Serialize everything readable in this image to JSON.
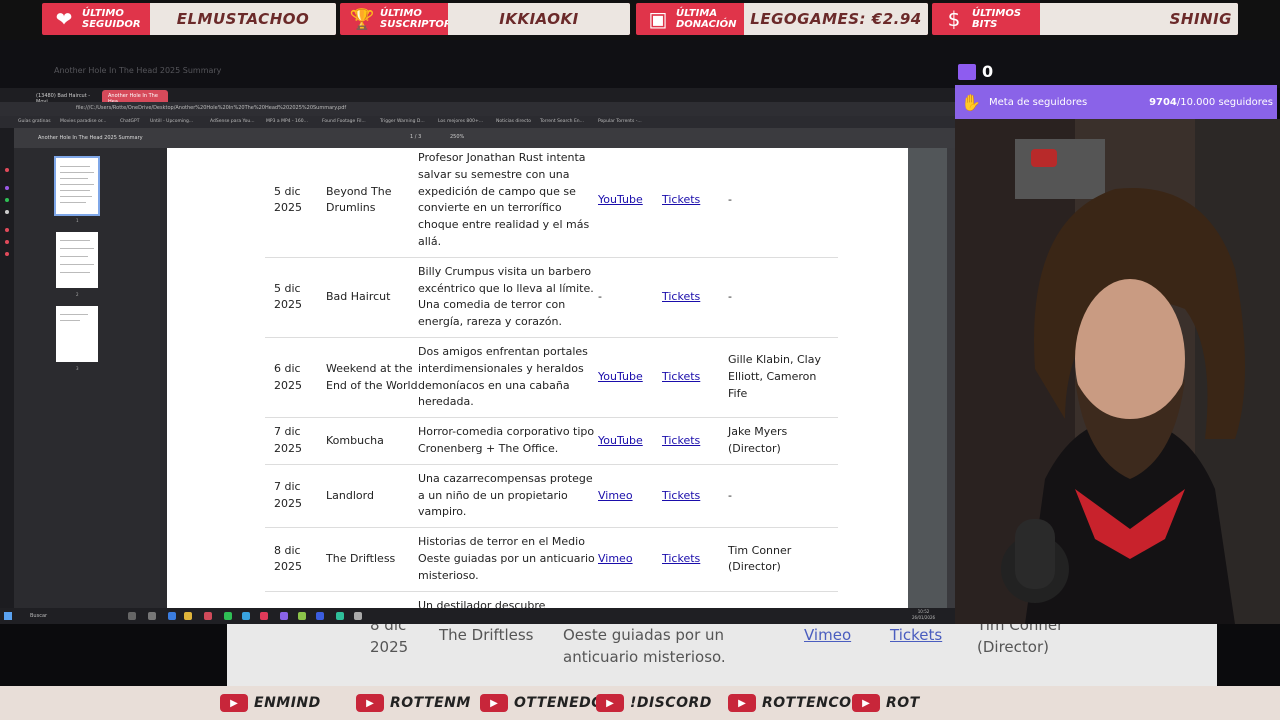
{
  "alerts": [
    {
      "label": "Último seguidor",
      "value": "ELMUSTACHOO",
      "icon": "heart-icon"
    },
    {
      "label": "Último suscriptor",
      "value": "IKKIAOKI",
      "icon": "trophy-icon"
    },
    {
      "label": "Última donación",
      "value": "LEGOGAMES: €2.94",
      "icon": "cash-register-icon"
    },
    {
      "label": "Últimos bits",
      "value": "SHINIG",
      "icon": "money-bag-icon"
    }
  ],
  "background_window": {
    "title": "Another Hole In The Head 2025 Summary"
  },
  "browser": {
    "tabs": [
      {
        "label": "(13480) Bad Haircut - Movi"
      },
      {
        "label": "Another Hole In The Hea"
      }
    ],
    "url": "file:///C:/Users/Rotte/OneDrive/Desktop/Another%20Hole%20In%20The%20Head%202025%20Summary.pdf",
    "bookmarks": [
      "Guías gratinas",
      "Movies paradise or...",
      "ChatGPT",
      "Untill - Upcoming...",
      "AdSense para You...",
      "MP3 a MP4 - 160...",
      "Found Footage Fil...",
      "Trigger Warning D...",
      "Los mejores 800+...",
      "Noticias directo",
      "Torrent Search En...",
      "Popular Torrents -..."
    ]
  },
  "pdf_viewer": {
    "title": "Another Hole In The Head 2025 Summary",
    "page_current": "1",
    "page_total": "3",
    "zoom": "250%",
    "thumbnails": [
      "1",
      "2",
      "3"
    ]
  },
  "films": [
    {
      "date": "5 dic 2025",
      "title": "Beyond The Drumlins",
      "description": "Profesor Jonathan Rust intenta salvar su semestre con una expedición de campo que se convierte en un terrorífico choque entre realidad y el más allá.",
      "trailer": "YouTube",
      "tickets": "Tickets",
      "director": "-"
    },
    {
      "date": "5 dic 2025",
      "title": "Bad Haircut",
      "description": "Billy Crumpus visita un barbero excéntrico que lo lleva al límite. Una comedia de terror con energía, rareza y corazón.",
      "trailer": "-",
      "tickets": "Tickets",
      "director": "-"
    },
    {
      "date": "6 dic 2025",
      "title": "Weekend at the End of the World",
      "description": "Dos amigos enfrentan portales interdimensionales y heraldos demoníacos en una cabaña heredada.",
      "trailer": "YouTube",
      "tickets": "Tickets",
      "director": "Gille Klabin, Clay Elliott, Cameron Fife"
    },
    {
      "date": "7 dic 2025",
      "title": "Kombucha",
      "description": "Horror-comedia corporativo tipo Cronenberg + The Office.",
      "trailer": "YouTube",
      "tickets": "Tickets",
      "director": "Jake Myers (Director)"
    },
    {
      "date": "7 dic 2025",
      "title": "Landlord",
      "description": "Una cazarrecompensas protege a un niño de un propietario vampiro.",
      "trailer": "Vimeo",
      "tickets": "Tickets",
      "director": "-"
    },
    {
      "date": "8 dic 2025",
      "title": "The Driftless",
      "description": "Historias de terror en el Medio Oeste guiadas por un anticuario misterioso.",
      "trailer": "Vimeo",
      "tickets": "Tickets",
      "director": "Tim Conner (Director)"
    },
    {
      "date": "",
      "title": "",
      "description": "Un destilador descubre",
      "trailer": "",
      "tickets": "",
      "director": ""
    }
  ],
  "taskbar": {
    "search_placeholder": "Buscar",
    "time": "10:52",
    "date": "26/01/2026"
  },
  "bg_pdf_zoom": {
    "date": "8 dic 2025",
    "title": "The Driftless",
    "description": "Oeste guiadas por un anticuario misterioso.",
    "trailer": "Vimeo",
    "tickets": "Tickets",
    "director_line1": "Tim Conner",
    "director_line2": "(Director)"
  },
  "twitch": {
    "viewer_count": "0"
  },
  "follower_goal": {
    "title": "Meta de seguidores",
    "current": "9704",
    "target": "/10.000 seguidores"
  },
  "ticker": [
    {
      "icon": "youtube-icon",
      "text": "ENMIND"
    },
    {
      "icon": "steam-icon",
      "text": "ROTTENM"
    },
    {
      "icon": "twitter-icon",
      "text": "OTTENEDGA"
    },
    {
      "icon": "discord-icon",
      "text": "!DISCORD"
    },
    {
      "icon": "instagram-icon",
      "text": "ROTTENCO"
    },
    {
      "icon": "twitch-icon",
      "text": "ROT"
    }
  ],
  "colors": {
    "alert_red": "#e0344a",
    "goal_purple": "#8a63e8",
    "link_blue": "#1a0dab",
    "active_tab": "#d64a5a"
  }
}
